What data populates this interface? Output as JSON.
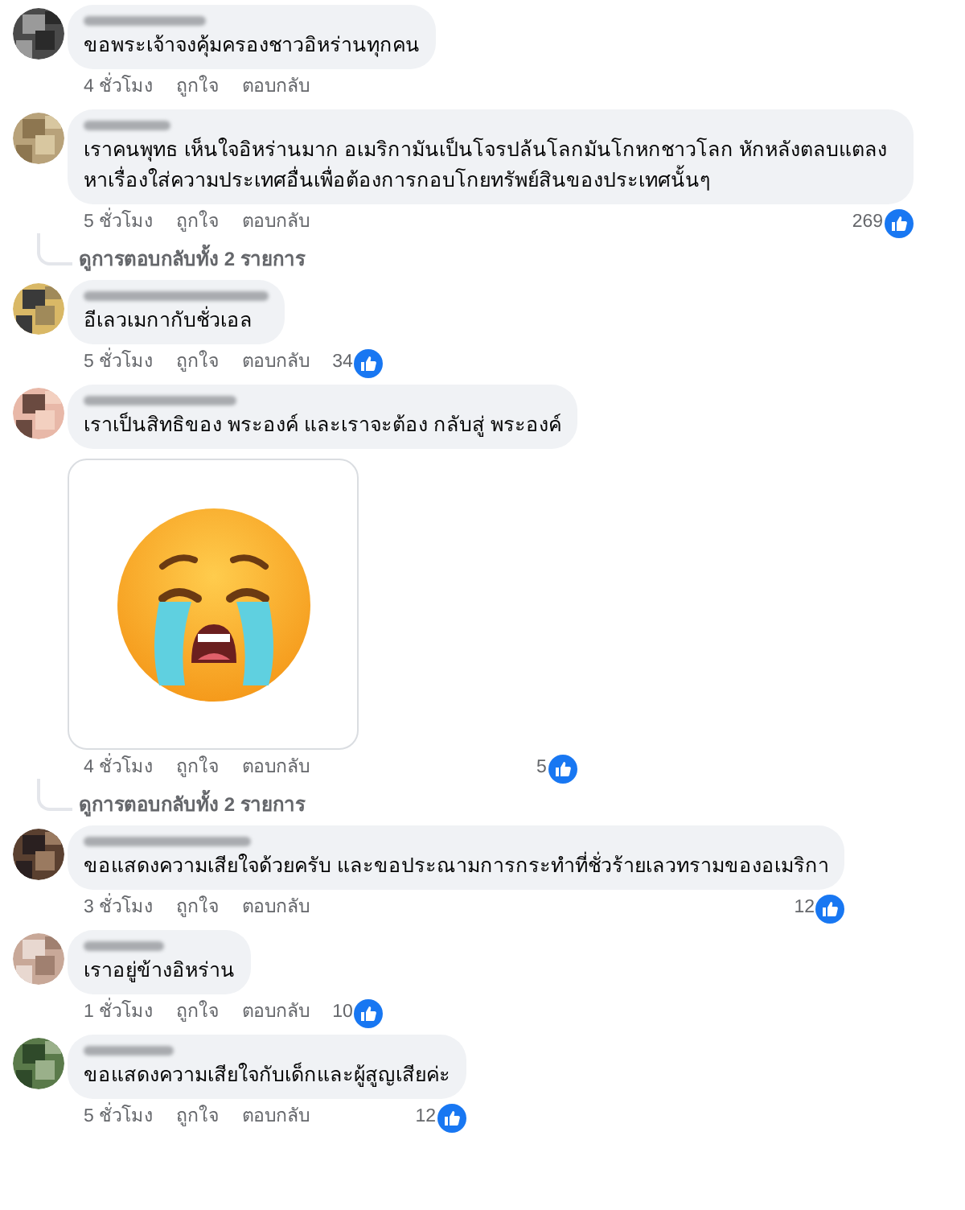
{
  "comments": [
    {
      "text": "ขอพระเจ้าจงคุ้มครองชาวอิหร่านทุกคน",
      "time": "4 ชั่วโมง",
      "like": "ถูกใจ",
      "reply": "ตอบกลับ"
    },
    {
      "text": "เราคนพุทธ เห็นใจอิหร่านมาก อเมริกามันเป็นโจรปล้นโลกมันโกหกชาวโลก หักหลังตลบแตลง หาเรื่องใส่ความประเทศอื่นเพื่อต้องการกอบโกยทรัพย์สินของประเทศนั้นๆ",
      "time": "5 ชั่วโมง",
      "like": "ถูกใจ",
      "reply": "ตอบกลับ",
      "reactions": "269",
      "view_replies": "ดูการตอบกลับทั้ง 2 รายการ"
    },
    {
      "text": "อีเลวเมกากับชั่วเอล",
      "time": "5 ชั่วโมง",
      "like": "ถูกใจ",
      "reply": "ตอบกลับ",
      "reactions": "34"
    },
    {
      "text": "เราเป็นสิทธิของ พระองค์ และเราจะต้อง กลับสู่ พระองค์",
      "attachment": {
        "kind": "sticker"
      },
      "time": "4 ชั่วโมง",
      "like": "ถูกใจ",
      "reply": "ตอบกลับ",
      "reactions": "5",
      "view_replies": "ดูการตอบกลับทั้ง 2 รายการ"
    },
    {
      "text": "ขอแสดงความเสียใจด้วยครับ และขอประณามการกระทำที่ชั่วร้ายเลวทรามของอเมริกา",
      "time": "3 ชั่วโมง",
      "like": "ถูกใจ",
      "reply": "ตอบกลับ",
      "reactions": "12"
    },
    {
      "text": "เราอยู่ข้างอิหร่าน",
      "time": "1 ชั่วโมง",
      "like": "ถูกใจ",
      "reply": "ตอบกลับ",
      "reactions": "10"
    },
    {
      "text": "ขอแสดงความเสียใจกับเด็กและผู้สูญเสียค่ะ",
      "time": "5 ชั่วโมง",
      "like": "ถูกใจ",
      "reply": "ตอบกลับ",
      "reactions": "12"
    }
  ]
}
